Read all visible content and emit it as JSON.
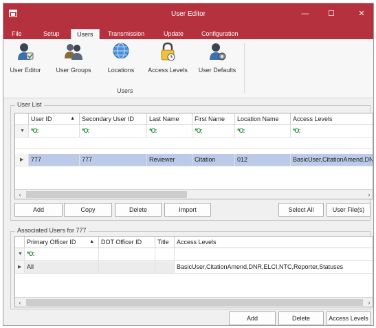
{
  "window": {
    "title": "User Editor",
    "minimize": "—",
    "maximize": "☐",
    "close": "✕"
  },
  "menu_tabs": [
    {
      "label": "File"
    },
    {
      "label": "Setup"
    },
    {
      "label": "Users"
    },
    {
      "label": "Transmission"
    },
    {
      "label": "Update"
    },
    {
      "label": "Configuration"
    }
  ],
  "ribbon": {
    "buttons": [
      {
        "label": "User Editor",
        "icon": "user-icon"
      },
      {
        "label": "User Groups",
        "icon": "users-group-icon"
      },
      {
        "label": "Locations",
        "icon": "globe-icon"
      },
      {
        "label": "Access Levels",
        "icon": "lock-icon"
      },
      {
        "label": "User Defaults",
        "icon": "user-defaults-icon"
      }
    ],
    "group_label": "Users"
  },
  "user_list": {
    "title": "User List",
    "columns": [
      "User ID",
      "Secondary User ID",
      "Last Name",
      "First Name",
      "Location Name",
      "Access Levels"
    ],
    "filter_glyph": "*O:",
    "rows": [
      {
        "user_id": "777",
        "secondary_id": "777",
        "last_name": "Reviewer",
        "first_name": "Citation",
        "location": "012",
        "access_levels": "BasicUser,CitationAmend,DN"
      }
    ],
    "buttons": {
      "add": "Add",
      "copy": "Copy",
      "delete": "Delete",
      "import": "Import",
      "select_all": "Select All",
      "user_files": "User File(s)"
    }
  },
  "associated": {
    "title": "Associated Users for 777",
    "columns": [
      "Primary Officer ID",
      "DOT Officer ID",
      "Title",
      "Access Levels"
    ],
    "filter_glyph": "*O:",
    "rows": [
      {
        "primary_id": "All",
        "dot_id": "",
        "title": "",
        "access_levels": "BasicUser,CitationAmend,DNR,ELCI,NTC,Reporter,Statuses"
      }
    ]
  },
  "bottom_buttons": {
    "add": "Add",
    "delete": "Delete",
    "access_levels": "Access Levels"
  },
  "colors": {
    "title_bar": "#b5313e",
    "selected_row": "#b9cbe8",
    "filter_glyph": "#2e8b3a"
  }
}
